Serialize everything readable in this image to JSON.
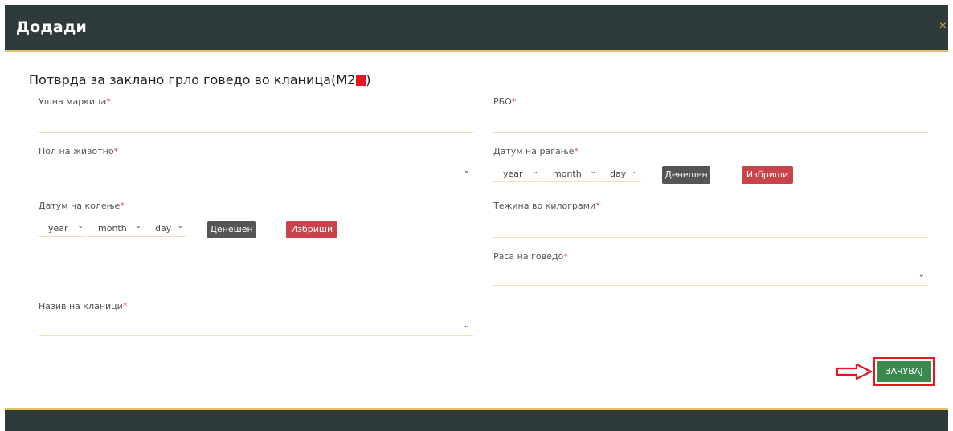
{
  "header": {
    "title": "Додади",
    "close": "×"
  },
  "form": {
    "title": "Потврда за заклано грло говедо во кланица(М2",
    "title_end": ")",
    "required_mark": "*",
    "ear_tag": {
      "label": "Ушна маркица",
      "value": ""
    },
    "rbo": {
      "label": "РБО",
      "value": ""
    },
    "sex": {
      "label": "Пол на животно",
      "value": ""
    },
    "birth_date": {
      "label": "Датум на раѓање",
      "year": "year",
      "month": "month",
      "day": "day"
    },
    "slaughter_date": {
      "label": "Датум на колење",
      "year": "year",
      "month": "month",
      "day": "day"
    },
    "weight": {
      "label": "Тежина во килограми",
      "value": ""
    },
    "breed": {
      "label": "Раса на говедо",
      "value": ""
    },
    "slaughterhouse": {
      "label": "Назив на кланици",
      "value": ""
    },
    "today_label": "Денешен",
    "delete_label": "Избриши",
    "save_label": "ЗАЧУВАЈ"
  },
  "colors": {
    "header_bg": "#2f3a3a",
    "accent": "#e2c16a",
    "save": "#3a8a4f",
    "delete": "#c9434a",
    "highlight": "#e8141f"
  }
}
